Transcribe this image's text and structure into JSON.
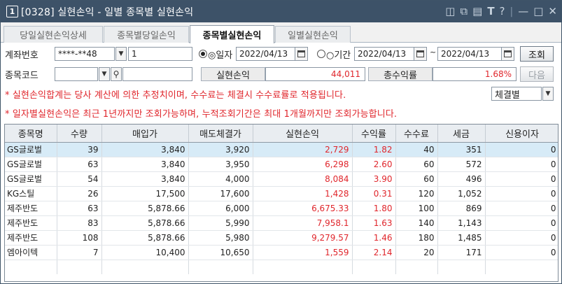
{
  "window": {
    "number": "1",
    "title": "[0328] 실현손익 - 일별 종목별 실현손익",
    "icons": [
      "layout-icon",
      "copy-icon",
      "pin-icon",
      "font-icon",
      "help-icon",
      "minimize-icon",
      "maximize-icon",
      "close-icon"
    ]
  },
  "tabs": [
    {
      "label": "당일실현손익상세",
      "active": false
    },
    {
      "label": "종목별당일손익",
      "active": false
    },
    {
      "label": "종목별실현손익",
      "active": true
    },
    {
      "label": "일별실현손익",
      "active": false
    }
  ],
  "form": {
    "account_label": "계좌번호",
    "account_number": "****-**48",
    "account_sub": "1",
    "radio_date_label": "◎일자",
    "date_single": "2022/04/13",
    "radio_period_label": "○기간",
    "period_from": "2022/04/13",
    "period_sep": "~",
    "period_to": "2022/04/13",
    "search_button": "조회",
    "code_label": "종목코드",
    "code_value": "",
    "code_name": "",
    "realized_label": "실현손익",
    "realized_value": "44,011",
    "return_label": "총수익률",
    "return_value": "1.68%",
    "next_button": "다음",
    "filter_value": "체결별"
  },
  "notices": [
    "* 실현손익합계는 당사 계산에 의한 추정치이며, 수수료는 체결시 수수료률로 적용됩니다.",
    "* 일자별실현손익은 최근 1년까지만 조회가능하며, 누적조회기간은 최대 1개월까지만 조회가능합니다."
  ],
  "table": {
    "columns": [
      "종목명",
      "수량",
      "매입가",
      "매도체결가",
      "실현손익",
      "수익률",
      "수수료",
      "세금",
      "신용이자"
    ],
    "rows": [
      [
        "GS글로벌",
        "39",
        "3,840",
        "3,920",
        "2,729",
        "1.82",
        "40",
        "351",
        "0"
      ],
      [
        "GS글로벌",
        "63",
        "3,840",
        "3,950",
        "6,298",
        "2.60",
        "60",
        "572",
        "0"
      ],
      [
        "GS글로벌",
        "54",
        "3,840",
        "4,000",
        "8,084",
        "3.90",
        "60",
        "496",
        "0"
      ],
      [
        "KG스틸",
        "26",
        "17,500",
        "17,600",
        "1,428",
        "0.31",
        "120",
        "1,052",
        "0"
      ],
      [
        "제주반도",
        "63",
        "5,878.66",
        "6,000",
        "6,675.33",
        "1.80",
        "100",
        "869",
        "0"
      ],
      [
        "제주반도",
        "83",
        "5,878.66",
        "5,990",
        "7,958.1",
        "1.63",
        "140",
        "1,143",
        "0"
      ],
      [
        "제주반도",
        "108",
        "5,878.66",
        "5,980",
        "9,279.57",
        "1.46",
        "180",
        "1,485",
        "0"
      ],
      [
        "엠아이텍",
        "7",
        "10,400",
        "10,650",
        "1,559",
        "2.14",
        "20",
        "171",
        "0"
      ]
    ]
  },
  "colors": {
    "titlebar": "#3d5268",
    "profit": "#e0262c",
    "selected_row": "#d7ebf7"
  }
}
